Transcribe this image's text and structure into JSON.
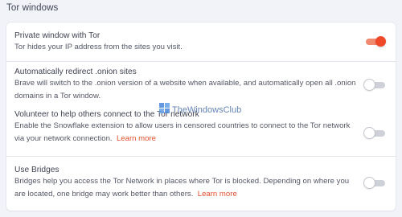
{
  "section": {
    "title": "Tor windows"
  },
  "settings": [
    {
      "title": "Private window with Tor",
      "desc": "Tor hides your IP address from the sites you visit.",
      "learn_more": "",
      "enabled": true
    },
    {
      "title": "Automatically redirect .onion sites",
      "desc": "Brave will switch to the .onion version of a website when available, and automatically open all .onion domains in a Tor window.",
      "learn_more": "",
      "enabled": false
    },
    {
      "title": "Volunteer to help others connect to the Tor network",
      "desc": "Enable the Snowflake extension to allow users in censored countries to connect to the Tor network via your network connection.",
      "learn_more": "Learn more",
      "enabled": false
    },
    {
      "title": "Use Bridges",
      "desc": "Bridges help you access the Tor Network in places where Tor is blocked. Depending on where you are located, one bridge may work better than others.",
      "learn_more": "Learn more",
      "enabled": false
    }
  ],
  "watermark": {
    "text": "TheWindowsClub",
    "icon": "windows-logo-icon"
  },
  "colors": {
    "accent": "#f0492a",
    "link": "#e2502e",
    "background": "#f1f3f9"
  }
}
